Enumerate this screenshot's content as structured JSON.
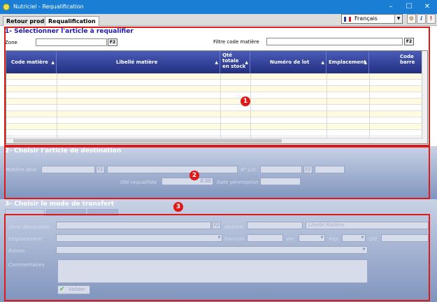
{
  "window": {
    "title": "Nutriciel - Requalification",
    "minimize": "–",
    "maximize": "☐",
    "close": "✕"
  },
  "tabs": [
    {
      "label": "Retour produit"
    },
    {
      "label": "Requalification"
    }
  ],
  "toolbar": {
    "language": "Français",
    "info_label": "i"
  },
  "section1": {
    "title": "1- Sélectionner l'article à requalifier",
    "zone_label": "Zone",
    "zone_value": "",
    "zone_f2": "F2",
    "filter_label": "Filtre code matière",
    "filter_value": "",
    "filter_f2": "F2",
    "columns": [
      {
        "label": "Code matière"
      },
      {
        "label": "Libellé matière"
      },
      {
        "label": "Qté totale en stock"
      },
      {
        "label": "Numéro de lot"
      },
      {
        "label": "Emplacement"
      },
      {
        "label": "Code barre"
      }
    ]
  },
  "section2": {
    "title": "2- Choisir l'article de destination",
    "matiere_label": "Matière dest.",
    "f2": "F2",
    "lot_label": "N° Lot",
    "qty_label": "Qté requalifiée",
    "qty_value": "0.00",
    "peremption_label": "Date péremption"
  },
  "section3": {
    "title": "3- Choisir le mode de transfert",
    "zone_dest_label": "Zone destination",
    "f2": "F2",
    "matiere_label": "Matière",
    "libelle_placeholder": "Libellé Matière",
    "emplacement_label": "Emplacement",
    "formule_label": "Formule",
    "ver_label": "Ver.",
    "rep_label": "Rép.",
    "qte_label": "Qté",
    "raison_label": "Raison",
    "commentaires_label": "Commentaires",
    "valider_label": "Valider"
  },
  "markers": [
    "1",
    "2",
    "3"
  ],
  "colors": {
    "title_bar": "#1a7fd4",
    "section_title": "#1c1cb4",
    "grid_header": "#2e3a94",
    "highlight": "#e01818"
  }
}
